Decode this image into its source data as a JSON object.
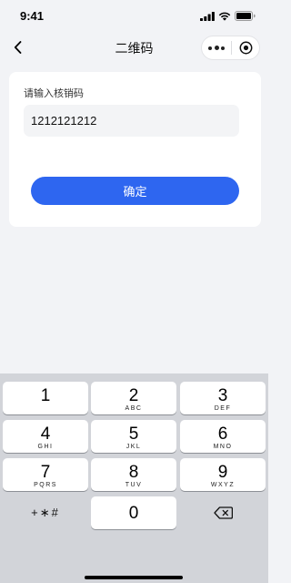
{
  "status_bar": {
    "time": "9:41"
  },
  "nav": {
    "title": "二维码"
  },
  "form": {
    "label": "请输入核销码",
    "value": "1212121212",
    "confirm_label": "确定"
  },
  "keyboard": {
    "keys": [
      {
        "digit": "1",
        "letters": ""
      },
      {
        "digit": "2",
        "letters": "ABC"
      },
      {
        "digit": "3",
        "letters": "DEF"
      },
      {
        "digit": "4",
        "letters": "GHI"
      },
      {
        "digit": "5",
        "letters": "JKL"
      },
      {
        "digit": "6",
        "letters": "MNO"
      },
      {
        "digit": "7",
        "letters": "PQRS"
      },
      {
        "digit": "8",
        "letters": "TUV"
      },
      {
        "digit": "9",
        "letters": "WXYZ"
      }
    ],
    "symbols_label": "+∗#",
    "zero": "0",
    "delete_icon": "backspace-icon"
  },
  "colors": {
    "accent": "#2e66f0",
    "background": "#f2f3f6",
    "keyboard_bg": "#d2d4d9"
  }
}
